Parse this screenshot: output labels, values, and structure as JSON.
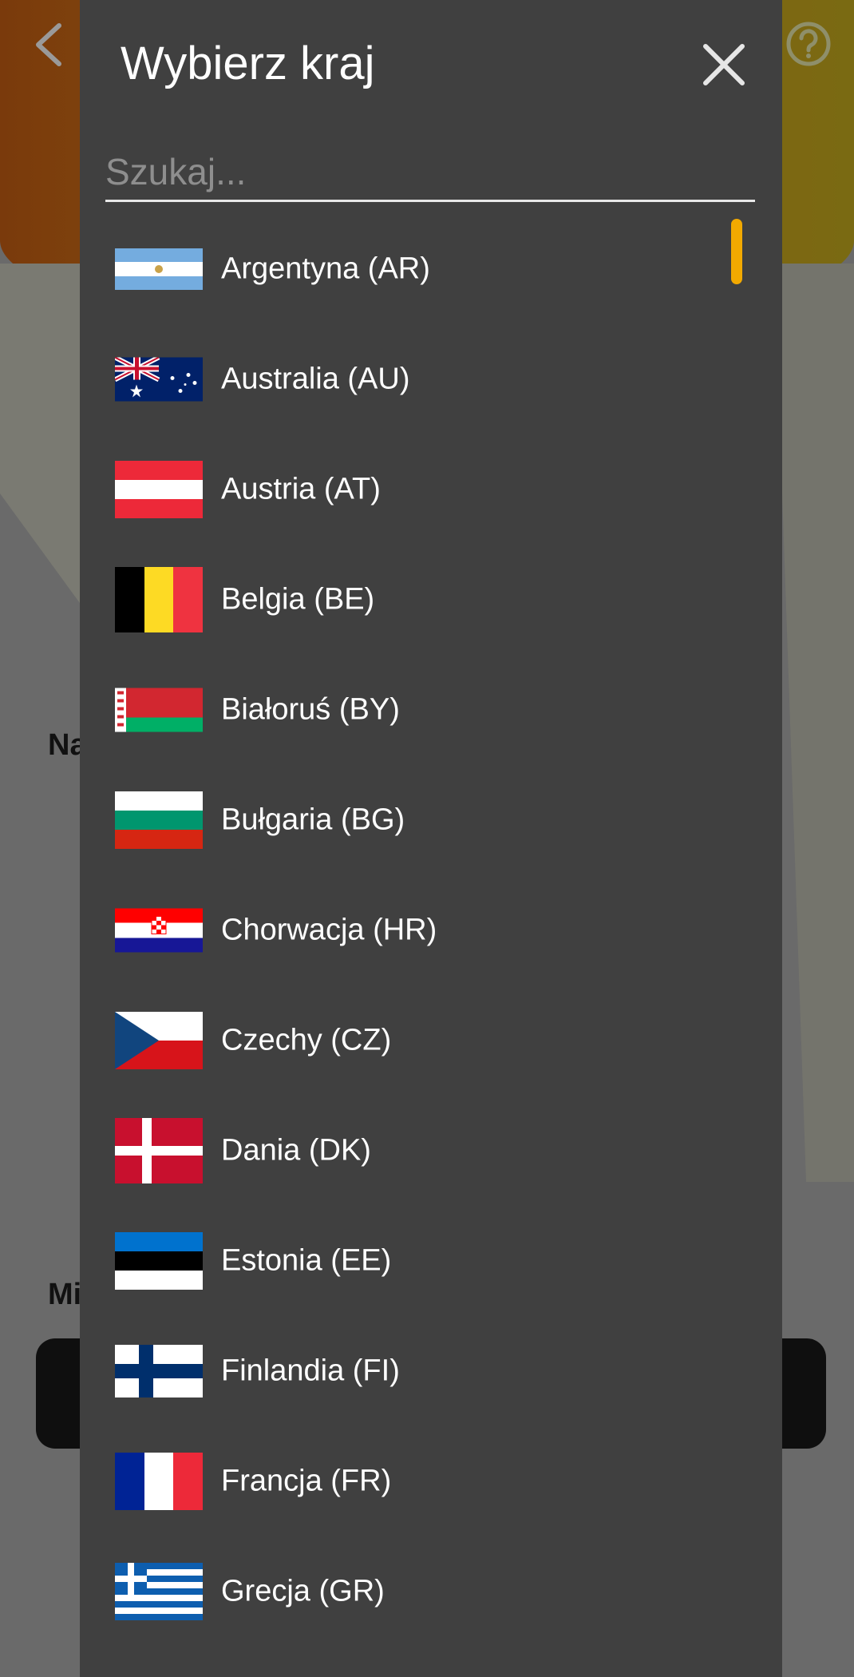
{
  "background": {
    "label_1": "Na",
    "label_2": "Mi"
  },
  "modal": {
    "title": "Wybierz kraj",
    "search_placeholder": "Szukaj...",
    "search_value": ""
  },
  "countries": [
    {
      "label": "Argentyna (AR)",
      "code": "AR"
    },
    {
      "label": "Australia (AU)",
      "code": "AU"
    },
    {
      "label": "Austria (AT)",
      "code": "AT"
    },
    {
      "label": "Belgia (BE)",
      "code": "BE"
    },
    {
      "label": "Białoruś (BY)",
      "code": "BY"
    },
    {
      "label": "Bułgaria (BG)",
      "code": "BG"
    },
    {
      "label": "Chorwacja (HR)",
      "code": "HR"
    },
    {
      "label": "Czechy (CZ)",
      "code": "CZ"
    },
    {
      "label": "Dania (DK)",
      "code": "DK"
    },
    {
      "label": "Estonia (EE)",
      "code": "EE"
    },
    {
      "label": "Finlandia (FI)",
      "code": "FI"
    },
    {
      "label": "Francja (FR)",
      "code": "FR"
    },
    {
      "label": "Grecja (GR)",
      "code": "GR"
    }
  ],
  "icons": {
    "back": "chevron-left-icon",
    "help": "help-circle-icon",
    "close": "close-icon"
  },
  "colors": {
    "modal_bg": "#404040",
    "scroll_accent": "#f2a900",
    "overlay_bg": "#6a6a6a"
  }
}
